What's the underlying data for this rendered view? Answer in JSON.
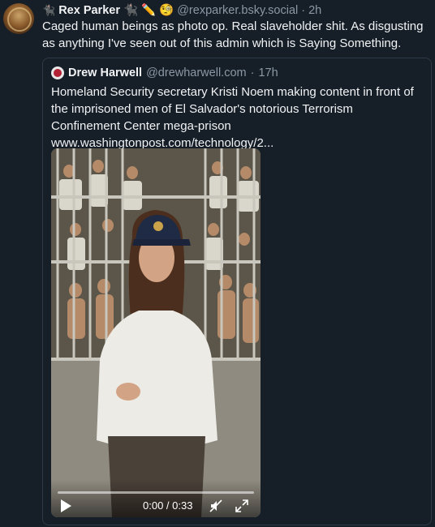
{
  "post": {
    "author_name": "Rex Parker",
    "author_emojis": "🐈‍⬛ ✏️ 🧐",
    "handle": "@rexparker.bsky.social",
    "separator": "·",
    "age": "2h",
    "text": "Caged human beings as photo op. Real slaveholder shit. As disgusting as anything I've seen out of this admin which is Saying Something."
  },
  "quote": {
    "author_name": "Drew Harwell",
    "handle": "@drewharwell.com",
    "separator": "·",
    "age": "17h",
    "text": "Homeland Security secretary Kristi Noem making content in front of the imprisoned men of El Salvador's notorious Terrorism Confinement Center mega-prison",
    "link": "www.washingtonpost.com/technology/2..."
  },
  "video": {
    "time": "0:00 / 0:33",
    "progress": 0,
    "icons": [
      "play-icon",
      "mute-icon",
      "fullscreen-icon"
    ]
  }
}
